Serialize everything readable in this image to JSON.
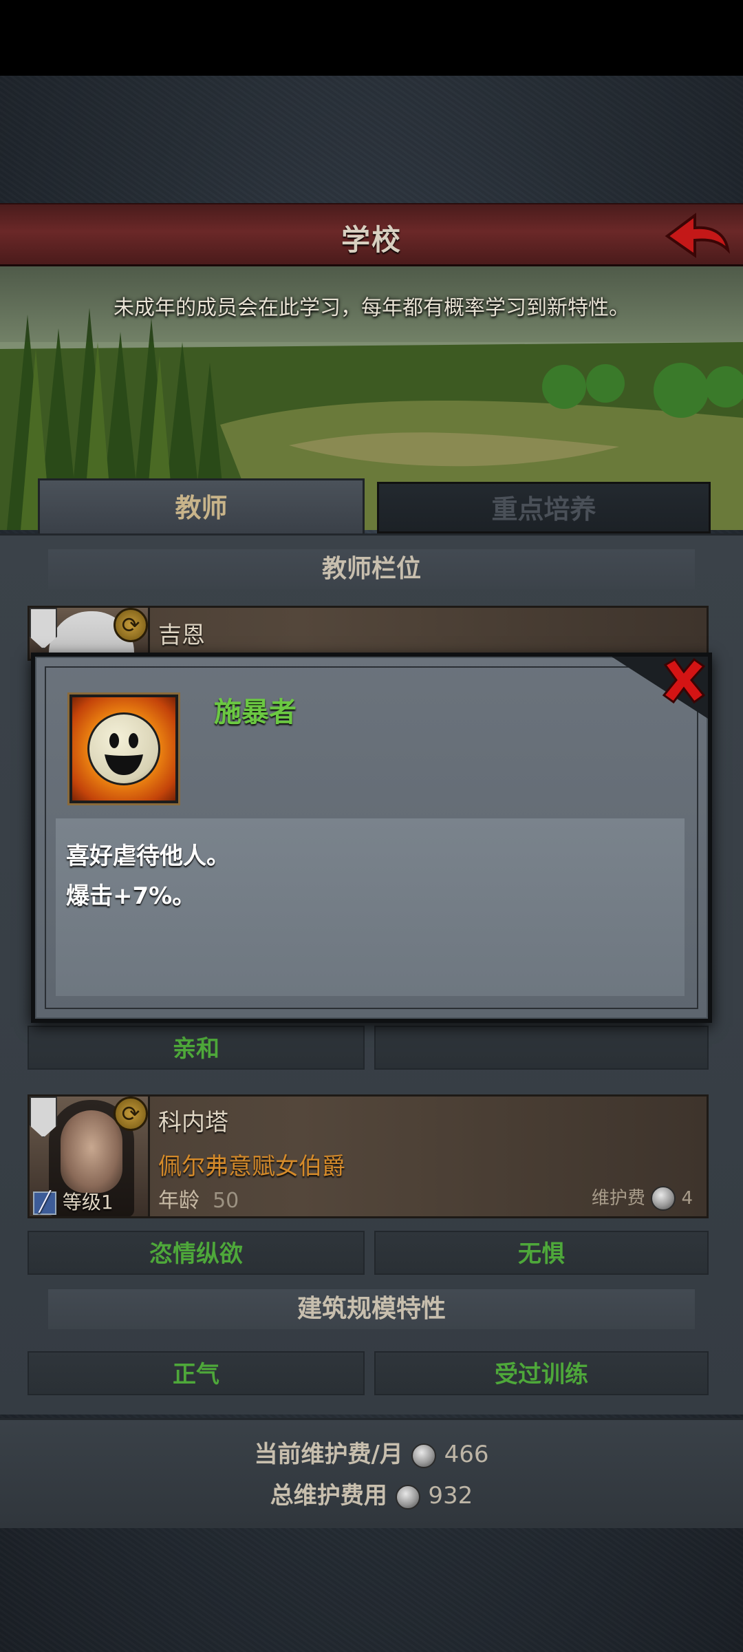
{
  "header": {
    "title": "学校"
  },
  "banner": {
    "description": "未成年的成员会在此学习，每年都有概率学习到新特性。"
  },
  "tabs": [
    {
      "label": "教师",
      "active": true
    },
    {
      "label": "重点培养",
      "active": false
    }
  ],
  "teacher_slots": {
    "title": "教师栏位",
    "teachers": [
      {
        "name": "吉恩"
      },
      {
        "name": "科内塔",
        "title": "佩尔弗意赋女伯爵",
        "age_label": "年龄",
        "age": "50",
        "level_label": "等级",
        "level": "1",
        "upkeep_label": "维护费",
        "upkeep": "4",
        "traits": [
          "恣情纵欲",
          "无惧"
        ]
      }
    ],
    "hidden_row_trait": "亲和"
  },
  "building_traits": {
    "title": "建筑规模特性",
    "traits": [
      "正气",
      "受过训练"
    ]
  },
  "footer": {
    "monthly_label": "当前维护费/月",
    "monthly_value": "466",
    "total_label": "总维护费用",
    "total_value": "932"
  },
  "modal": {
    "trait_name": "施暴者",
    "description_line1": "喜好虐待他人。",
    "description_line2": "爆击+7%。"
  },
  "colors": {
    "header_red": "#6b2828",
    "trait_green": "#4ea83a",
    "title_orange": "#d48a2a",
    "tab_active_text": "#c8b48a"
  }
}
